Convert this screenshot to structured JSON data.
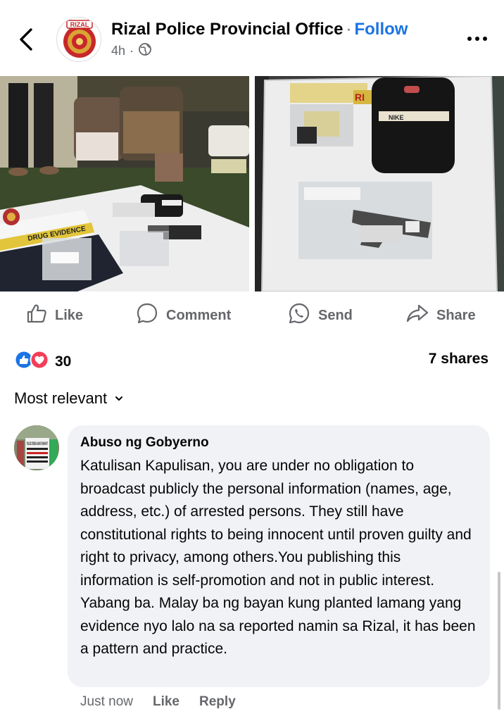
{
  "post": {
    "page_name": "Rizal Police Provincial Office",
    "separator": "·",
    "follow_label": "Follow",
    "time": "4h",
    "time_dot": "·",
    "logo_text": "RIZAL"
  },
  "photos": {
    "left_banner_label": "DRUG EVIDENCE",
    "right_banner_label": "RI",
    "bag_brand": "NIKE"
  },
  "actions": {
    "like": "Like",
    "comment": "Comment",
    "send": "Send",
    "share": "Share"
  },
  "reactions": {
    "count": "30",
    "shares": "7 shares"
  },
  "sort_label": "Most relevant",
  "comment": {
    "author": "Abuso ng Gobyerno",
    "avatar_sign_text": "POLICE CRIMES AGAINST HUMANITY",
    "text": "Katulisan Kapulisan, you are under no obligation to broadcast publicly the personal information (names, age, address, etc.) of arrested persons. They still have constitutional rights to being innocent until proven guilty and right to privacy, among others.You publishing this information is self-promotion and not in public interest. Yabang ba. Malay ba ng bayan kung planted lamang yang evidence nyo lalo na sa reported namin sa Rizal, it has been a pattern and practice.",
    "time": "Just now",
    "like_label": "Like",
    "reply_label": "Reply"
  },
  "colors": {
    "accent": "#1b74e4",
    "muted": "#65676b",
    "bubble": "#f0f2f5",
    "love": "#f33e58"
  }
}
